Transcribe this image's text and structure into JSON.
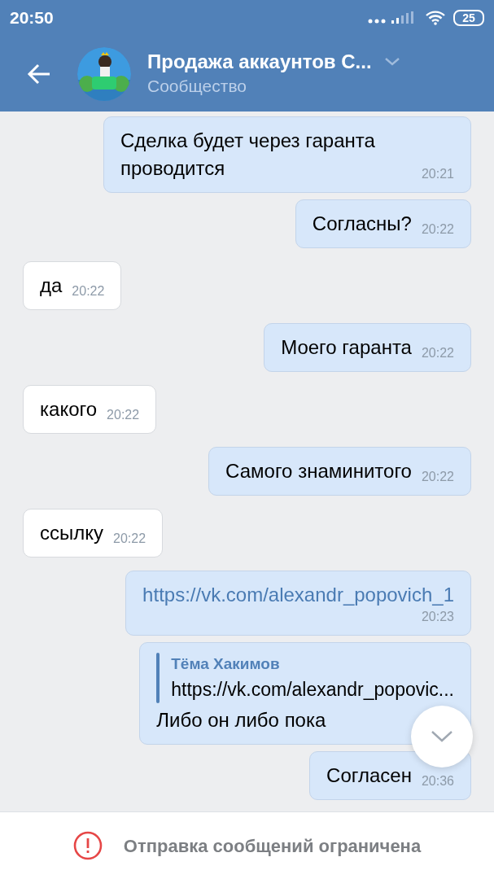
{
  "status_bar": {
    "time": "20:50",
    "battery": "25"
  },
  "header": {
    "title": "Продажа аккаунтов С...",
    "subtitle": "Сообщество"
  },
  "messages": [
    {
      "kind": "text",
      "outgoing": true,
      "text": "Сделка будет через гаранта проводится",
      "time": "20:21"
    },
    {
      "kind": "text",
      "outgoing": true,
      "text": "Согласны?",
      "time": "20:22"
    },
    {
      "kind": "text",
      "outgoing": false,
      "text": "да",
      "time": "20:22"
    },
    {
      "kind": "text",
      "outgoing": true,
      "text": "Моего гаранта",
      "time": "20:22"
    },
    {
      "kind": "text",
      "outgoing": false,
      "text": "какого",
      "time": "20:22"
    },
    {
      "kind": "text",
      "outgoing": true,
      "text": "Самого знаминитого",
      "time": "20:22"
    },
    {
      "kind": "text",
      "outgoing": false,
      "text": "ссылку",
      "time": "20:22"
    },
    {
      "kind": "link",
      "outgoing": true,
      "text": "https://vk.com/alexandr_popovich_1",
      "time": "20:23"
    },
    {
      "kind": "forward",
      "outgoing": true,
      "author": "Тёма Хакимов",
      "quote": "https://vk.com/alexandr_popovic...",
      "text": "Либо он либо пока"
    },
    {
      "kind": "text",
      "outgoing": true,
      "text": "Согласен",
      "time": "20:36"
    }
  ],
  "notice": "Отправка сообщений ограничена"
}
